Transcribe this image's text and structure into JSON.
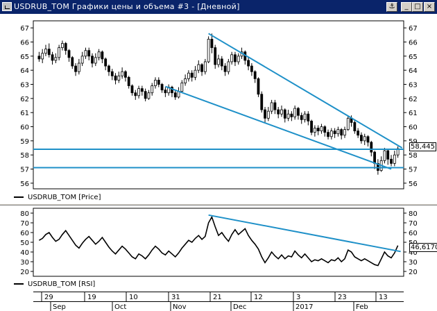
{
  "window": {
    "title": "USDRUB_TOM Графики цены и объема #3 - [Дневной]",
    "buttons": [
      "⚓",
      "_",
      "□",
      "×"
    ]
  },
  "price_panel": {
    "legend": "USDRUB_TOM [Price]",
    "last_value": "58,445",
    "y_ticks": [
      "67",
      "66",
      "65",
      "64",
      "63",
      "62",
      "61",
      "60",
      "59",
      "58",
      "57",
      "56"
    ]
  },
  "rsi_panel": {
    "legend": "USDRUB_TOM [RSI]",
    "last_value": "46,6170",
    "y_ticks": [
      "80",
      "70",
      "60",
      "50",
      "40",
      "30",
      "20"
    ]
  },
  "time_axis": {
    "day_labels": [
      "29",
      "19",
      "10",
      "31",
      "21",
      "12",
      "3",
      "23",
      "13"
    ],
    "month_labels": [
      "Sep",
      "Oct",
      "Nov",
      "Dec",
      "2017",
      "Feb"
    ]
  },
  "colors": {
    "candle": "#000000",
    "trendline": "#1e90c8",
    "background": "#ffffff",
    "title_bar": "#0a246a"
  },
  "chart_data": [
    {
      "type": "candlestick",
      "series": [
        {
          "name": "USDRUB_TOM [Price]",
          "ohlc": [
            [
              65.0,
              64.8,
              65.3,
              64.6
            ],
            [
              64.8,
              65.2,
              65.5,
              64.5
            ],
            [
              65.2,
              65.5,
              65.8,
              65.0
            ],
            [
              65.5,
              65.1,
              65.9,
              64.9
            ],
            [
              65.1,
              64.7,
              65.3,
              64.4
            ],
            [
              64.7,
              64.9,
              65.2,
              64.5
            ],
            [
              64.9,
              65.6,
              65.8,
              64.7
            ],
            [
              65.6,
              65.9,
              66.1,
              65.4
            ],
            [
              65.9,
              65.4,
              66.0,
              65.1
            ],
            [
              65.4,
              64.9,
              65.5,
              64.6
            ],
            [
              64.9,
              64.3,
              65.0,
              64.1
            ],
            [
              64.3,
              63.9,
              64.5,
              63.6
            ],
            [
              63.9,
              64.5,
              64.8,
              63.7
            ],
            [
              64.5,
              65.0,
              65.3,
              64.3
            ],
            [
              65.0,
              65.4,
              65.6,
              64.8
            ],
            [
              65.4,
              65.0,
              65.6,
              64.7
            ],
            [
              65.0,
              64.5,
              65.2,
              64.2
            ],
            [
              64.5,
              64.9,
              65.2,
              64.3
            ],
            [
              64.9,
              65.3,
              65.5,
              64.7
            ],
            [
              65.3,
              64.8,
              65.4,
              64.5
            ],
            [
              64.8,
              64.3,
              64.9,
              64.0
            ],
            [
              64.3,
              63.9,
              64.4,
              63.6
            ],
            [
              63.9,
              63.6,
              64.1,
              63.3
            ],
            [
              63.6,
              63.3,
              63.8,
              63.0
            ],
            [
              63.3,
              63.6,
              63.9,
              63.1
            ],
            [
              63.6,
              63.9,
              64.2,
              63.4
            ],
            [
              63.9,
              63.5,
              64.0,
              63.2
            ],
            [
              63.5,
              62.9,
              63.6,
              62.7
            ],
            [
              62.9,
              62.4,
              63.0,
              62.2
            ],
            [
              62.4,
              62.2,
              62.6,
              61.9
            ],
            [
              62.2,
              62.7,
              62.9,
              62.0
            ],
            [
              62.7,
              62.5,
              62.9,
              62.2
            ],
            [
              62.5,
              62.0,
              62.7,
              61.8
            ],
            [
              62.0,
              62.4,
              62.6,
              61.9
            ],
            [
              62.4,
              62.9,
              63.1,
              62.2
            ],
            [
              62.9,
              63.3,
              63.5,
              62.7
            ],
            [
              63.3,
              63.0,
              63.5,
              62.8
            ],
            [
              63.0,
              62.6,
              63.1,
              62.4
            ],
            [
              62.6,
              62.4,
              62.8,
              62.1
            ],
            [
              62.4,
              62.8,
              63.0,
              62.2
            ],
            [
              62.8,
              62.4,
              62.9,
              62.1
            ],
            [
              62.4,
              62.1,
              62.6,
              61.9
            ],
            [
              62.1,
              62.5,
              62.8,
              62.0
            ],
            [
              62.5,
              63.1,
              63.3,
              62.4
            ],
            [
              63.1,
              63.4,
              63.7,
              62.9
            ],
            [
              63.4,
              63.8,
              64.0,
              63.2
            ],
            [
              63.8,
              63.5,
              64.0,
              63.2
            ],
            [
              63.5,
              64.0,
              64.3,
              63.3
            ],
            [
              64.0,
              64.4,
              64.7,
              63.8
            ],
            [
              64.4,
              63.9,
              64.5,
              63.6
            ],
            [
              63.9,
              64.6,
              64.8,
              63.7
            ],
            [
              64.6,
              66.2,
              66.4,
              64.5
            ],
            [
              66.2,
              65.6,
              66.6,
              65.2
            ],
            [
              65.6,
              64.4,
              65.8,
              64.1
            ],
            [
              64.4,
              64.8,
              65.1,
              64.2
            ],
            [
              64.8,
              64.3,
              65.0,
              64.0
            ],
            [
              64.3,
              63.9,
              64.5,
              63.6
            ],
            [
              63.9,
              64.6,
              64.8,
              63.7
            ],
            [
              64.6,
              65.1,
              65.3,
              64.4
            ],
            [
              65.1,
              64.6,
              65.3,
              64.3
            ],
            [
              64.6,
              65.0,
              65.2,
              64.4
            ],
            [
              65.0,
              65.3,
              65.6,
              64.8
            ],
            [
              65.3,
              64.7,
              65.4,
              64.4
            ],
            [
              64.7,
              64.3,
              64.9,
              64.0
            ],
            [
              64.3,
              63.9,
              64.5,
              63.6
            ],
            [
              63.9,
              63.4,
              64.0,
              63.1
            ],
            [
              63.4,
              62.3,
              63.5,
              62.1
            ],
            [
              62.3,
              61.2,
              62.5,
              61.0
            ],
            [
              61.2,
              60.6,
              61.4,
              60.3
            ],
            [
              60.6,
              61.1,
              61.4,
              60.4
            ],
            [
              61.1,
              61.7,
              61.9,
              60.9
            ],
            [
              61.7,
              61.2,
              61.9,
              60.9
            ],
            [
              61.2,
              60.9,
              61.4,
              60.6
            ],
            [
              60.9,
              61.2,
              61.5,
              60.7
            ],
            [
              61.2,
              60.6,
              61.3,
              60.3
            ],
            [
              60.6,
              60.9,
              61.2,
              60.4
            ],
            [
              60.9,
              60.7,
              61.1,
              60.4
            ],
            [
              60.7,
              61.3,
              61.5,
              60.5
            ],
            [
              61.3,
              60.8,
              61.4,
              60.5
            ],
            [
              60.8,
              60.5,
              61.0,
              60.2
            ],
            [
              60.5,
              60.9,
              61.1,
              60.3
            ],
            [
              60.9,
              60.4,
              61.1,
              60.1
            ],
            [
              60.4,
              59.6,
              60.5,
              59.4
            ],
            [
              59.6,
              59.9,
              60.1,
              59.3
            ],
            [
              59.9,
              59.7,
              60.1,
              59.4
            ],
            [
              59.7,
              60.0,
              60.2,
              59.5
            ],
            [
              60.0,
              59.6,
              60.1,
              59.3
            ],
            [
              59.6,
              59.3,
              59.8,
              59.1
            ],
            [
              59.3,
              59.7,
              59.9,
              59.1
            ],
            [
              59.7,
              59.5,
              59.9,
              59.2
            ],
            [
              59.5,
              59.8,
              60.0,
              59.3
            ],
            [
              59.8,
              59.4,
              59.9,
              59.1
            ],
            [
              59.4,
              59.8,
              60.0,
              59.2
            ],
            [
              59.8,
              60.6,
              60.8,
              59.7
            ],
            [
              60.6,
              60.3,
              60.8,
              60.0
            ],
            [
              60.3,
              59.7,
              60.5,
              59.5
            ],
            [
              59.7,
              59.4,
              59.9,
              59.2
            ],
            [
              59.4,
              59.0,
              59.6,
              58.8
            ],
            [
              59.0,
              59.3,
              59.5,
              58.7
            ],
            [
              59.3,
              58.9,
              59.4,
              58.6
            ],
            [
              58.9,
              58.2,
              59.0,
              57.9
            ],
            [
              58.2,
              57.4,
              58.3,
              57.0
            ],
            [
              57.4,
              56.9,
              57.7,
              56.6
            ],
            [
              56.9,
              57.6,
              57.9,
              56.8
            ],
            [
              57.6,
              58.3,
              58.5,
              57.4
            ],
            [
              58.3,
              57.7,
              58.4,
              57.3
            ],
            [
              57.7,
              57.4,
              58.0,
              57.2
            ],
            [
              57.4,
              58.0,
              58.3,
              57.2
            ],
            [
              58.0,
              58.445,
              58.6,
              57.8
            ]
          ]
        }
      ],
      "annotations": [
        "trend line",
        "trend line",
        "horizontal line 58.4",
        "horizontal line 57.1"
      ],
      "ylim": [
        55.6,
        67.5
      ]
    },
    {
      "type": "line",
      "series": [
        {
          "name": "USDRUB_TOM [RSI]",
          "values": [
            52,
            54,
            58,
            60,
            55,
            51,
            53,
            58,
            62,
            57,
            52,
            47,
            44,
            49,
            53,
            56,
            52,
            48,
            51,
            55,
            50,
            45,
            41,
            38,
            42,
            46,
            43,
            39,
            35,
            33,
            38,
            36,
            33,
            37,
            42,
            46,
            43,
            39,
            37,
            41,
            38,
            35,
            39,
            44,
            48,
            52,
            50,
            54,
            57,
            53,
            56,
            70,
            76,
            66,
            57,
            60,
            55,
            51,
            58,
            63,
            58,
            61,
            64,
            57,
            52,
            48,
            43,
            35,
            29,
            34,
            40,
            36,
            33,
            37,
            33,
            36,
            35,
            41,
            37,
            34,
            38,
            34,
            30,
            32,
            31,
            33,
            31,
            29,
            32,
            31,
            34,
            30,
            33,
            42,
            40,
            35,
            33,
            31,
            33,
            31,
            29,
            27,
            26,
            33,
            40,
            36,
            34,
            39,
            46.617
          ]
        }
      ],
      "annotations": [
        "trend line"
      ],
      "ylim": [
        15,
        85
      ]
    }
  ]
}
